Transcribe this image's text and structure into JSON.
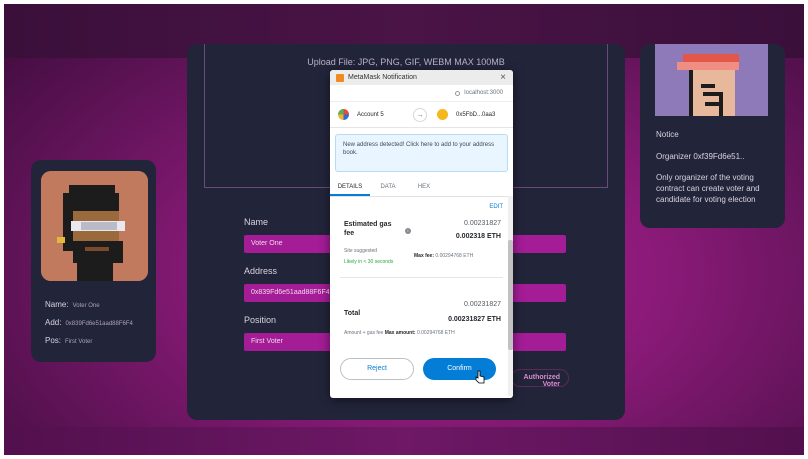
{
  "form": {
    "upload_hint": "Upload File: JPG, PNG, GIF, WEBM MAX 100MB",
    "name_label": "Name",
    "name_value": "Voter One",
    "address_label": "Address",
    "address_value": "0x839Fd6e51aad88F6F4",
    "position_label": "Position",
    "position_value": "First Voter",
    "submit_label": "Authorized Voter"
  },
  "voter_card": {
    "name_label": "Name:",
    "name_value": "Voter One",
    "address_label": "Add:",
    "address_value": "0x839Fd6e51aad88F6F4",
    "position_label": "Pos:",
    "position_value": "First Voter"
  },
  "notice_card": {
    "title": "Notice",
    "organizer": "Organizer 0xf39Fd6e51..",
    "description": "Only organizer of the voting contract can create voter and candidate for voting election"
  },
  "metamask": {
    "window_title": "MetaMask Notification",
    "origin": "localhost:3000",
    "from_account": "Account 5",
    "to_account": "0x5FbD...0aa3",
    "notice_text": "New address detected! Click here to add to your address book.",
    "tabs": [
      "DETAILS",
      "DATA",
      "HEX"
    ],
    "edit_label": "EDIT",
    "gas_label": "Estimated gas fee",
    "gas_fee_secondary": "0.00231827",
    "gas_fee_primary": "0.002318 ETH",
    "site_suggested": "Site suggested",
    "likely_time": "Likely in < 30 seconds",
    "max_fee_label": "Max fee:",
    "max_fee_value": "0.00294768 ETH",
    "total_label": "Total",
    "total_secondary": "0.00231827",
    "total_primary": "0.00231827 ETH",
    "amount_line": "Amount + gas fee",
    "max_amount_label": "Max amount:",
    "max_amount_value": "0.00294768 ETH",
    "reject_label": "Reject",
    "confirm_label": "Confirm"
  },
  "colors": {
    "background": "#8a1a78",
    "panel": "#22243a",
    "input": "#a41c96",
    "metamask_blue": "#037dd6"
  }
}
